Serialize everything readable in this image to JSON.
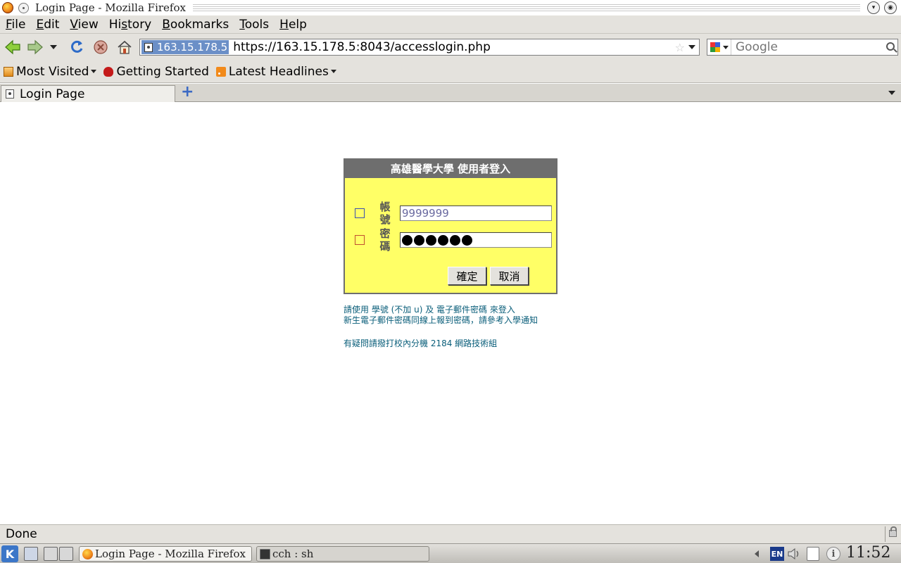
{
  "window": {
    "title": "Login Page - Mozilla Firefox"
  },
  "menubar": {
    "items": [
      {
        "label": "File",
        "accel": "F",
        "rest": "ile"
      },
      {
        "label": "Edit",
        "accel": "E",
        "rest": "dit"
      },
      {
        "label": "View",
        "accel": "V",
        "rest": "iew"
      },
      {
        "label": "History",
        "accel": "s",
        "pre": "Hi",
        "rest": "tory"
      },
      {
        "label": "Bookmarks",
        "accel": "B",
        "rest": "ookmarks"
      },
      {
        "label": "Tools",
        "accel": "T",
        "rest": "ools"
      },
      {
        "label": "Help",
        "accel": "H",
        "rest": "elp"
      }
    ]
  },
  "navbar": {
    "site_identity": "163.15.178.5",
    "url": "https://163.15.178.5:8043/accesslogin.php",
    "search_placeholder": "Google"
  },
  "bookmarks": {
    "items": [
      {
        "label": "Most Visited",
        "has_dropdown": true,
        "icon": "most-visited-icon"
      },
      {
        "label": "Getting Started",
        "has_dropdown": false,
        "icon": "firefox-bookmark-icon"
      },
      {
        "label": "Latest Headlines",
        "has_dropdown": true,
        "icon": "rss-feed-icon"
      }
    ]
  },
  "tabs": [
    {
      "label": "Login Page",
      "active": true
    }
  ],
  "login": {
    "header": "高雄醫學大學 使用者登入",
    "account_label": "帳號",
    "account_value": "9999999",
    "password_label": "密碼",
    "password_mask_count": 6,
    "ok_button": "確定",
    "cancel_button": "取消"
  },
  "info": {
    "line1": "請使用 學號 (不加 u) 及 電子郵件密碼 來登入",
    "line2": "新生電子郵件密碼同線上報到密碼，請參考入學通知",
    "line3": "有疑問請撥打校內分機 2184 網路技術組"
  },
  "statusbar": {
    "text": "Done"
  },
  "taskbar": {
    "tasks": [
      {
        "label": "Login Page - Mozilla Firefox",
        "active": true
      },
      {
        "label": "cch : sh",
        "active": false
      }
    ],
    "keyboard_layout": "EN",
    "clock": "11:52"
  },
  "colors": {
    "login_bg": "#ffff66",
    "login_header_bg": "#6e6e6e",
    "info_text": "#0a5e7a",
    "chrome_bg": "#e4e2dd"
  }
}
